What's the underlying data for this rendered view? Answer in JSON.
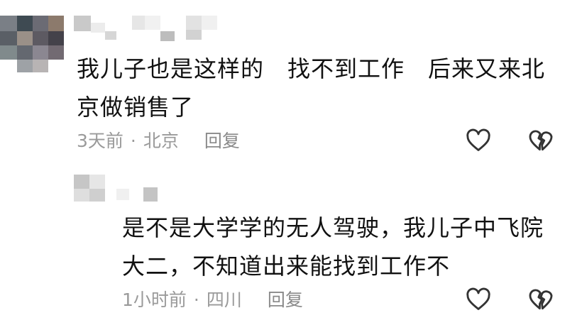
{
  "comments": [
    {
      "text": "我儿子也是这样的　找不到工作　后来又来北京做销售了",
      "time": "3天前",
      "separator": "·",
      "location": "北京",
      "reply_label": "回复",
      "like_icon": "heart-outline-icon",
      "dislike_icon": "broken-heart-icon"
    },
    {
      "text": "是不是大学学的无人驾驶，我儿子中飞院大二，不知道出来能找到工作不",
      "time": "1小时前",
      "separator": "·",
      "location": "四川",
      "reply_label": "回复",
      "like_icon": "heart-outline-icon",
      "dislike_icon": "broken-heart-icon"
    }
  ],
  "colors": {
    "text": "#111111",
    "meta": "#9a9a9a",
    "icon": "#333333"
  }
}
